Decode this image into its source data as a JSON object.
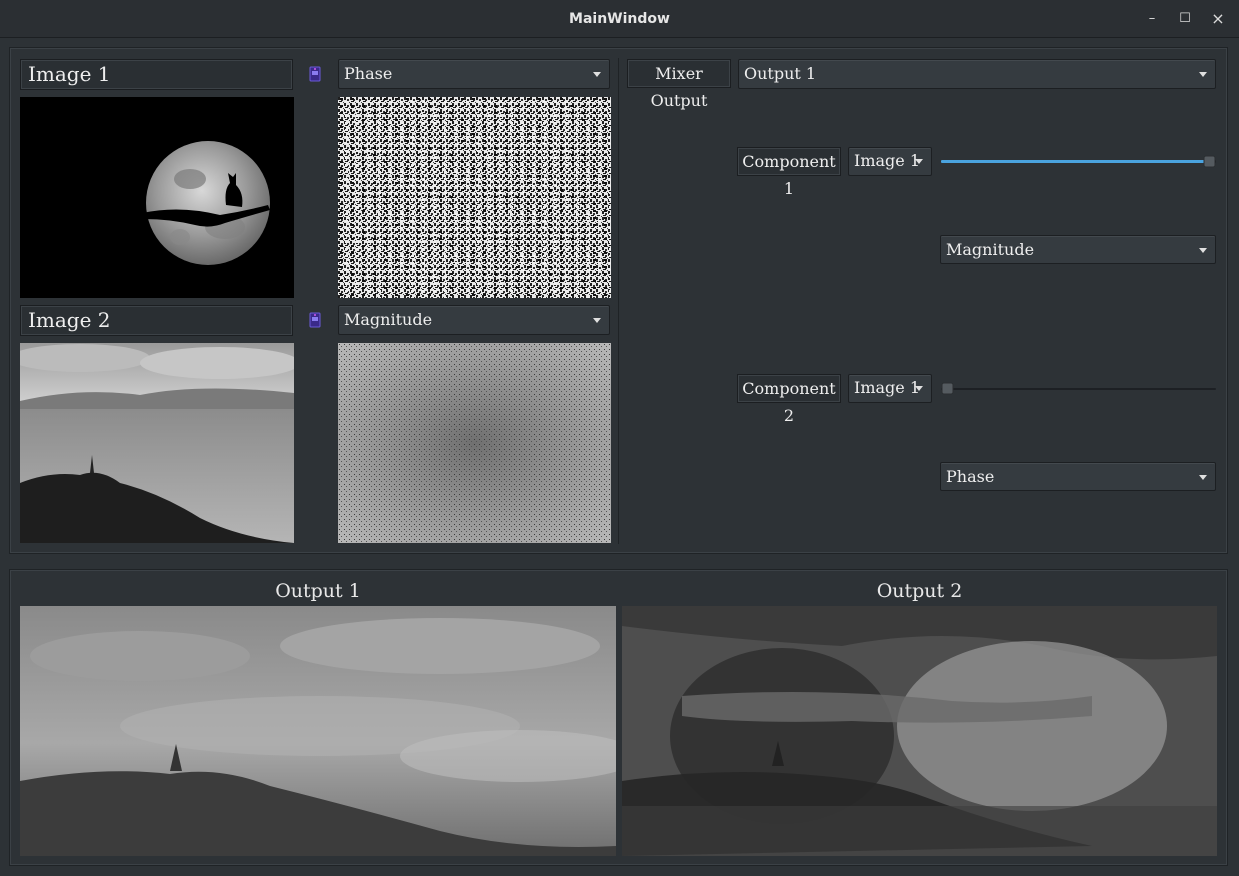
{
  "window": {
    "title": "MainWindow",
    "minimize": "–",
    "maximize": "☐",
    "close": "×"
  },
  "inputs": {
    "image1": {
      "label": "Image  1",
      "component": "Phase"
    },
    "image2": {
      "label": "Image  2",
      "component": "Magnitude"
    }
  },
  "mixer": {
    "label": "Mixer  Output",
    "output_select": "Output  1",
    "component1": {
      "label": "Component  1",
      "source": "Image  1",
      "weight": 1.0,
      "type": "Magnitude"
    },
    "component2": {
      "label": "Component  2",
      "source": "Image  1",
      "weight": 0.0,
      "type": "Phase"
    }
  },
  "outputs": {
    "output1": {
      "label": "Output  1"
    },
    "output2": {
      "label": "Output  2"
    }
  },
  "colors": {
    "slider_fill": "#4aa3df",
    "background": "#2d3236"
  }
}
